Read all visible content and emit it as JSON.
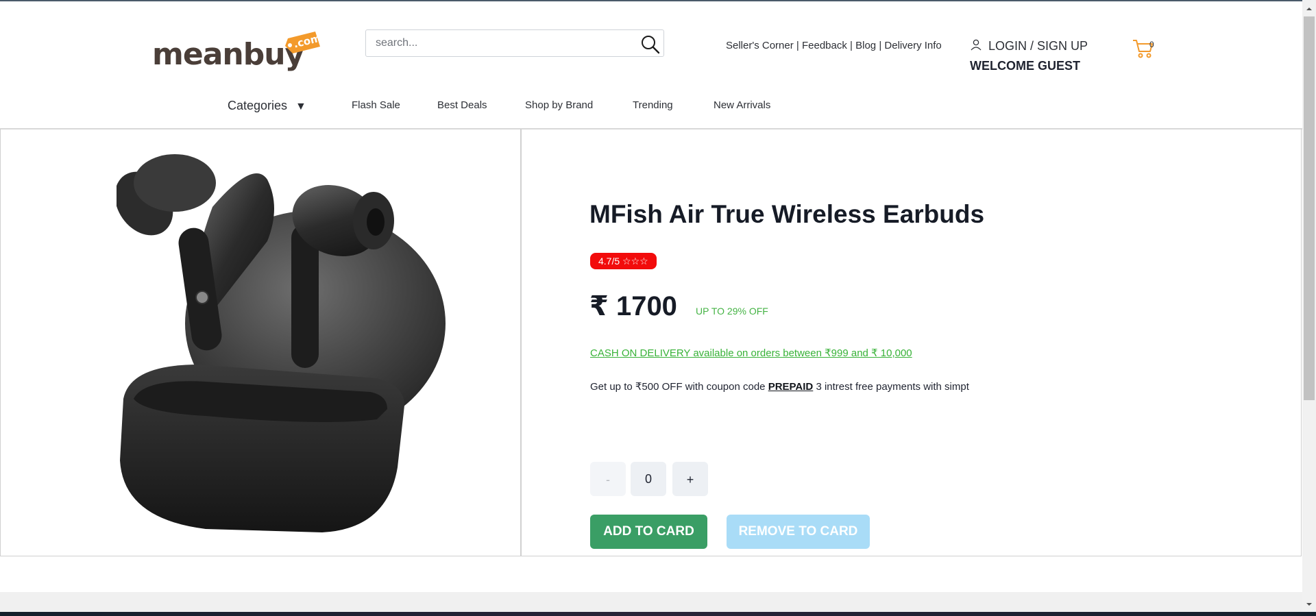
{
  "brand": {
    "name": "meanbuy",
    "tag": ".com",
    "colors": {
      "tag": "#f39a2b",
      "word": "#4a3e38"
    }
  },
  "search": {
    "placeholder": "search...",
    "icon": "search-icon"
  },
  "utility_links": {
    "sellers_corner": "Seller's Corner",
    "separator": "|",
    "feedback": "Feedback",
    "blog": "Blog",
    "delivery_info": "Delivery Info"
  },
  "account": {
    "login_signup": "LOGIN / SIGN UP",
    "welcome": "WELCOME GUEST",
    "icon": "user-icon"
  },
  "cart": {
    "count": "0",
    "icon": "cart-icon",
    "color": "#f39a2b"
  },
  "nav": {
    "categories": "Categories",
    "caret": "▼",
    "items": [
      "Flash Sale",
      "Best Deals",
      "Shop by Brand",
      "Trending",
      "New Arrivals"
    ]
  },
  "product": {
    "title": "MFish Air True Wireless Earbuds",
    "rating": "4.7/5 ☆☆☆",
    "price": "₹ 1700",
    "discount": "UP TO 29% OFF",
    "cod_notice": "CASH ON DELIVERY available on orders between ₹999 and ₹ 10,000",
    "coupon_prefix": "Get up to ₹500 OFF with coupon code",
    "coupon_code": "PREPAID",
    "coupon_suffix": "3 intrest free payments with simpt",
    "quantity": {
      "minus": "-",
      "value": "0",
      "plus": "+"
    },
    "add_button": "ADD TO CARD",
    "remove_button": "REMOVE TO CARD",
    "colors": {
      "rating_bg": "#f20c0c",
      "discount": "#44b344",
      "add": "#3a9e65",
      "remove": "#a9dcf7"
    }
  }
}
